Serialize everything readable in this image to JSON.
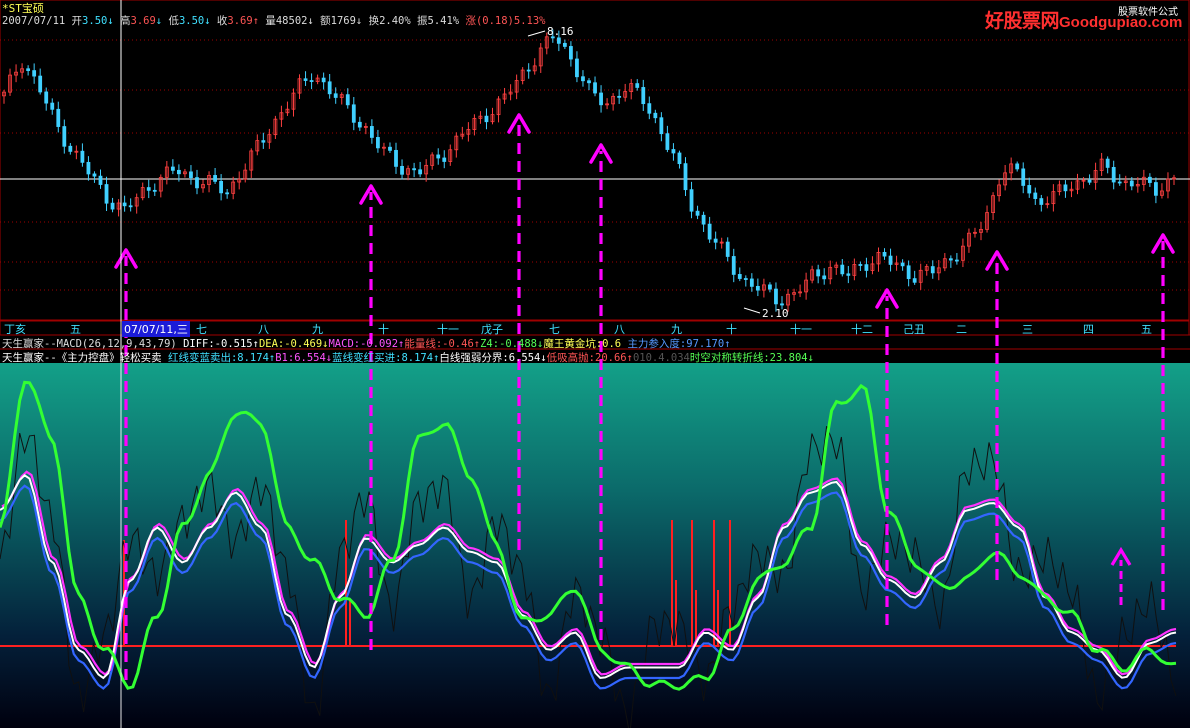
{
  "header": {
    "stock_name": "*ST宝硕",
    "date": "2007/07/11",
    "open_label": "开",
    "open_value": "3.50",
    "open_arrow": "↓",
    "high_label": "高",
    "high_value": "3.69",
    "high_arrow": "↓",
    "low_label": "低",
    "low_value": "3.50",
    "low_arrow": "↓",
    "close_label": "收",
    "close_value": "3.69",
    "close_arrow": "↑",
    "vol_label": "量",
    "vol_value": "48502",
    "vol_arrow": "↓",
    "amt_label": "额",
    "amt_value": "1769",
    "amt_arrow": "↓",
    "turn_label": "换",
    "turn_value": "2.40%",
    "amp_label": "振",
    "amp_value": "5.41%",
    "chg_label": "涨",
    "chg_value": "(0.18)5.13%"
  },
  "logo": {
    "cn": "好股票网",
    "en": "Goodgupiao.com",
    "tag": "股票软件公式"
  },
  "price_chart": {
    "max_label": "8.16",
    "min_label": "2.10"
  },
  "time_axis": {
    "labels": [
      "丁亥",
      "五",
      "07/07/11,三",
      "七",
      "八",
      "九",
      "十",
      "十一",
      "戊子",
      "七",
      "八",
      "九",
      "十",
      "十一",
      "十二",
      "己丑",
      "二",
      "三",
      "四",
      "五"
    ],
    "highlight_index": 2
  },
  "indicator_line1": [
    {
      "text": "天生赢家--MACD(26,12,9,43,79) ",
      "color": "#dcdcdc"
    },
    {
      "text": "DIFF:-0.515↑",
      "color": "#ffffff"
    },
    {
      "text": "DEA:-0.469↓",
      "color": "#ffff55"
    },
    {
      "text": "MACD:-0.092↑",
      "color": "#ff55ff"
    },
    {
      "text": "能量线:-0.46↑",
      "color": "#ff5555"
    },
    {
      "text": "Z4:-0.488↓",
      "color": "#55ff55"
    },
    {
      "text": "魔王黄金坑:0.6 ",
      "color": "#ffff55"
    },
    {
      "text": "主力参入度:97.170↑",
      "color": "#5599ff"
    }
  ],
  "indicator_line2": [
    {
      "text": "天生赢家--《主力控盘》轻松买卖 ",
      "color": "#ffffff"
    },
    {
      "text": "红线变蓝卖出:8.174↑",
      "color": "#40e0ff"
    },
    {
      "text": "B1:6.554↓",
      "color": "#ff55ff"
    },
    {
      "text": "蓝线变红买进:8.174↑",
      "color": "#40e0ff"
    },
    {
      "text": "白线强弱分界:6.554↓",
      "color": "#ffffff"
    },
    {
      "text": "低吸高抛:20.66↑",
      "color": "#ff5555"
    },
    {
      "text": "010.4.034",
      "color": "#555555"
    },
    {
      "text": "时空对称转折线:23.804↓",
      "color": "#55ff55"
    }
  ],
  "colors": {
    "up_candle": "#ff4040",
    "down_candle": "#40d0ff",
    "dotted_grid": "#a00000",
    "arrow": "#ff00ff",
    "panel_top": "#13a088",
    "panel_bottom": "#000010",
    "green_line": "#33ff33",
    "white_line": "#ffffff",
    "blue_line": "#3366ff",
    "magenta_line": "#ff33ff",
    "red_line": "#ff2020",
    "thin_line": "#101010"
  },
  "chart_data": {
    "type": "line",
    "title": "*ST宝硕",
    "price_panel": {
      "max": 8.16,
      "min": 2.1,
      "close_series": [
        6.8,
        7.6,
        7.0,
        6.2,
        5.6,
        5.1,
        4.6,
        4.3,
        4.7,
        5.0,
        5.2,
        5.0,
        4.9,
        4.7,
        5.3,
        5.8,
        6.4,
        6.9,
        7.3,
        6.9,
        6.5,
        6.1,
        5.6,
        5.3,
        5.1,
        5.4,
        5.7,
        6.1,
        6.4,
        6.7,
        7.2,
        7.7,
        8.1,
        7.6,
        6.9,
        6.6,
        7.0,
        6.8,
        6.2,
        5.4,
        4.4,
        3.8,
        3.3,
        2.8,
        2.6,
        2.4,
        2.5,
        2.9,
        3.1,
        2.9,
        3.2,
        3.3,
        3.1,
        2.9,
        3.0,
        3.3,
        3.6,
        4.1,
        5.2,
        5.1,
        4.5,
        4.6,
        4.9,
        5.0,
        5.3,
        4.9,
        4.9,
        4.8,
        5.0
      ]
    },
    "indicator_panel": {
      "series": [
        {
          "name": "时空对称转折线",
          "color": "green",
          "values": [
            55,
            98,
            80,
            35,
            20,
            10,
            30,
            55,
            70,
            88,
            85,
            55,
            45,
            35,
            30,
            45,
            80,
            85,
            70,
            50,
            28,
            30,
            38,
            20,
            15,
            10,
            10,
            12,
            25,
            40,
            45,
            55,
            90,
            95,
            60,
            45,
            38,
            40,
            48,
            42,
            35,
            30,
            20,
            15,
            20,
            15
          ]
        },
        {
          "name": "白线强弱分界",
          "color": "white",
          "values": [
            60,
            70,
            45,
            20,
            12,
            40,
            55,
            45,
            55,
            65,
            55,
            30,
            15,
            35,
            52,
            45,
            50,
            55,
            48,
            45,
            30,
            20,
            25,
            12,
            15,
            15,
            15,
            25,
            20,
            35,
            55,
            65,
            68,
            50,
            40,
            35,
            45,
            60,
            62,
            55,
            35,
            25,
            20,
            12,
            22,
            25
          ]
        }
      ],
      "signal_bars_at": [
        12,
        28,
        64,
        66,
        68,
        70,
        72
      ]
    },
    "buy_arrows_at_candle_index": [
      10,
      30,
      45,
      52,
      77,
      85,
      97
    ],
    "ylim": [
      2.1,
      8.16
    ]
  }
}
